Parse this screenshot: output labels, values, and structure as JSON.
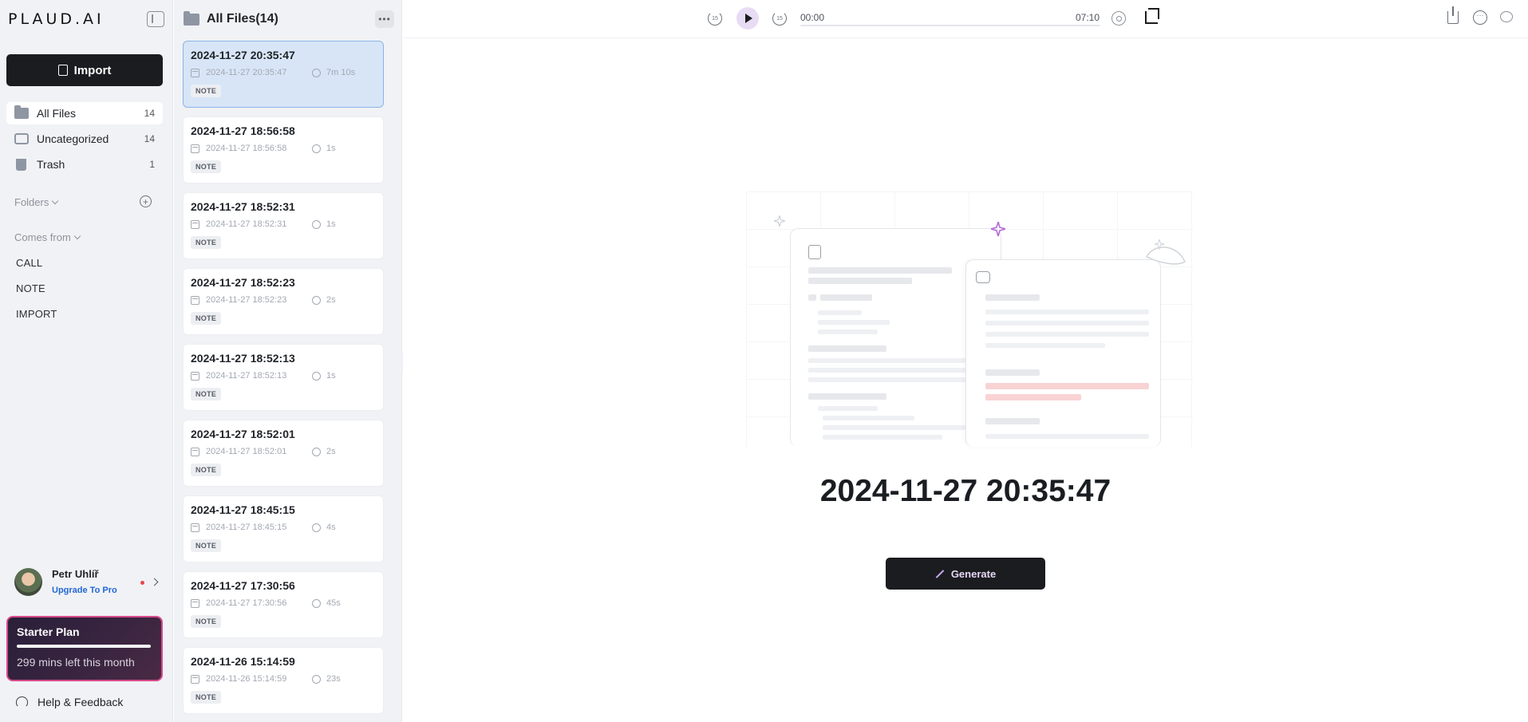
{
  "app": {
    "logo": "PLAUD.AI"
  },
  "sidebar": {
    "import_label": "Import",
    "nav": [
      {
        "label": "All Files",
        "count": "14",
        "icon": "folder-icon",
        "active": true
      },
      {
        "label": "Uncategorized",
        "count": "14",
        "icon": "inbox-icon",
        "active": false
      },
      {
        "label": "Trash",
        "count": "1",
        "icon": "trash-icon",
        "active": false
      }
    ],
    "folders_label": "Folders",
    "comes_from_label": "Comes from",
    "sources": [
      "CALL",
      "NOTE",
      "IMPORT"
    ],
    "user": {
      "name": "Petr Uhlíř",
      "upgrade_label": "Upgrade To Pro"
    },
    "plan": {
      "title": "Starter Plan",
      "subtitle": "299 mins left this month",
      "usage_fraction": 0.99
    },
    "help_label": "Help & Feedback"
  },
  "filelist": {
    "title": "All Files(14)",
    "files": [
      {
        "title": "2024-11-27 20:35:47",
        "date": "2024-11-27 20:35:47",
        "duration": "7m 10s",
        "tag": "NOTE",
        "active": true
      },
      {
        "title": "2024-11-27 18:56:58",
        "date": "2024-11-27 18:56:58",
        "duration": "1s",
        "tag": "NOTE",
        "active": false
      },
      {
        "title": "2024-11-27 18:52:31",
        "date": "2024-11-27 18:52:31",
        "duration": "1s",
        "tag": "NOTE",
        "active": false
      },
      {
        "title": "2024-11-27 18:52:23",
        "date": "2024-11-27 18:52:23",
        "duration": "2s",
        "tag": "NOTE",
        "active": false
      },
      {
        "title": "2024-11-27 18:52:13",
        "date": "2024-11-27 18:52:13",
        "duration": "1s",
        "tag": "NOTE",
        "active": false
      },
      {
        "title": "2024-11-27 18:52:01",
        "date": "2024-11-27 18:52:01",
        "duration": "2s",
        "tag": "NOTE",
        "active": false
      },
      {
        "title": "2024-11-27 18:45:15",
        "date": "2024-11-27 18:45:15",
        "duration": "4s",
        "tag": "NOTE",
        "active": false
      },
      {
        "title": "2024-11-27 17:30:56",
        "date": "2024-11-27 17:30:56",
        "duration": "45s",
        "tag": "NOTE",
        "active": false
      },
      {
        "title": "2024-11-26 15:14:59",
        "date": "2024-11-26 15:14:59",
        "duration": "23s",
        "tag": "NOTE",
        "active": false
      }
    ]
  },
  "player": {
    "current_time": "00:00",
    "total_time": "07:10",
    "skip_back_label": "15",
    "skip_forward_label": "15",
    "progress_fraction": 0
  },
  "main": {
    "title": "2024-11-27 20:35:47",
    "generate_label": "Generate"
  },
  "colors": {
    "accent_dark": "#1b1c1f",
    "active_card": "#d7e5f7",
    "upgrade_link": "#2167d6",
    "plan_border": "#d84a8a"
  }
}
